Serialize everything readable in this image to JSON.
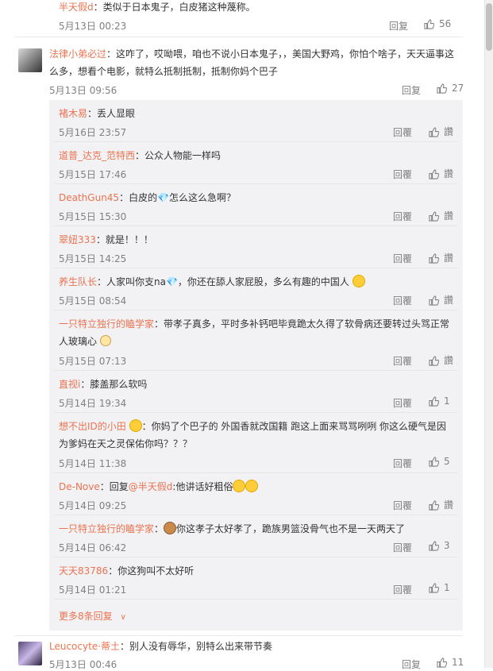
{
  "top": {
    "user": "半天假d",
    "text": "：类似于日本鬼子，白皮猪这种蔑称。",
    "time": "5月13日 00:23",
    "reply": "回复",
    "likes": "56"
  },
  "c2": {
    "user": "法律小弟必过",
    "text1": "：这咋了，哎呦喂，咱也不说小日本鬼子，，美国大野鸡，你怕个啥子，天天逼事这",
    "text2": "么多，想看个电影，就特么抵制抵制，抵制你妈个巴子",
    "time": "5月13日 09:56",
    "reply": "回复",
    "likes": "27"
  },
  "replies": [
    {
      "user": "褚木易",
      "text": "：丢人显眼",
      "time": "5月16日 23:57",
      "reply": "回覆",
      "like": "讚"
    },
    {
      "user": "道普_达克_范特西",
      "text": "：公众人物能一样吗",
      "time": "5月15日 17:46",
      "reply": "回覆",
      "like": "讚"
    },
    {
      "user": "DeathGun45",
      "text": "：白皮的💎怎么这么急啊？",
      "time": "5月15日 15:30",
      "reply": "回覆",
      "like": "讚"
    },
    {
      "user": "翠妞333",
      "text": "：就是！！！",
      "time": "5月15日 14:25",
      "reply": "回覆",
      "like": "讚"
    },
    {
      "user": "养生队长",
      "text": "：人家叫你支na💎，你还在舔人家屁股，多么有趣的中国人",
      "time": "5月15日 08:54",
      "reply": "回覆",
      "like": "讚"
    },
    {
      "user": "一只特立独行的瞌学家",
      "text": "：带孝子真多，平时多补钙吧毕竟跪太久得了软骨病还要转过头骂正常",
      "text2": "人玻璃心",
      "time": "5月15日 07:13",
      "reply": "回覆",
      "like": "讚"
    },
    {
      "user": "直视i",
      "text": "：膝盖那么软吗",
      "time": "5月14日 19:34",
      "reply": "回覆",
      "like": "1"
    },
    {
      "user": "想不出ID的小田",
      "text": "：你妈了个巴子的 外国香就改国籍 跑这上面来骂骂咧咧 你这么硬气是因",
      "text2": "为爹妈在天之灵保佑你吗？？？",
      "time": "5月14日 11:38",
      "reply": "回覆",
      "like": "5"
    },
    {
      "user": "De-Nove",
      "text_pre": "：回复",
      "mention": "@半天假d",
      "text": ":他讲话好粗俗",
      "time": "5月14日 09:25",
      "reply": "回覆",
      "like": "讚"
    },
    {
      "user": "一只特立独行的瞌学家",
      "text": "你这孝子太好孝了，跪族男篮没骨气也不是一天两天了",
      "time": "5月14日 06:42",
      "reply": "回覆",
      "like": "3"
    },
    {
      "user": "天天83786",
      "text": "：你这狗叫不太好听",
      "time": "5月14日 01:21",
      "reply": "回覆",
      "like": "1"
    }
  ],
  "more": "更多8条回复",
  "c3": {
    "user": "Leucocyte·蒂土",
    "text": "：别人没有辱华，别特么出来带节奏",
    "time": "5月13日 00:46",
    "reply": "回复",
    "likes": "11"
  }
}
